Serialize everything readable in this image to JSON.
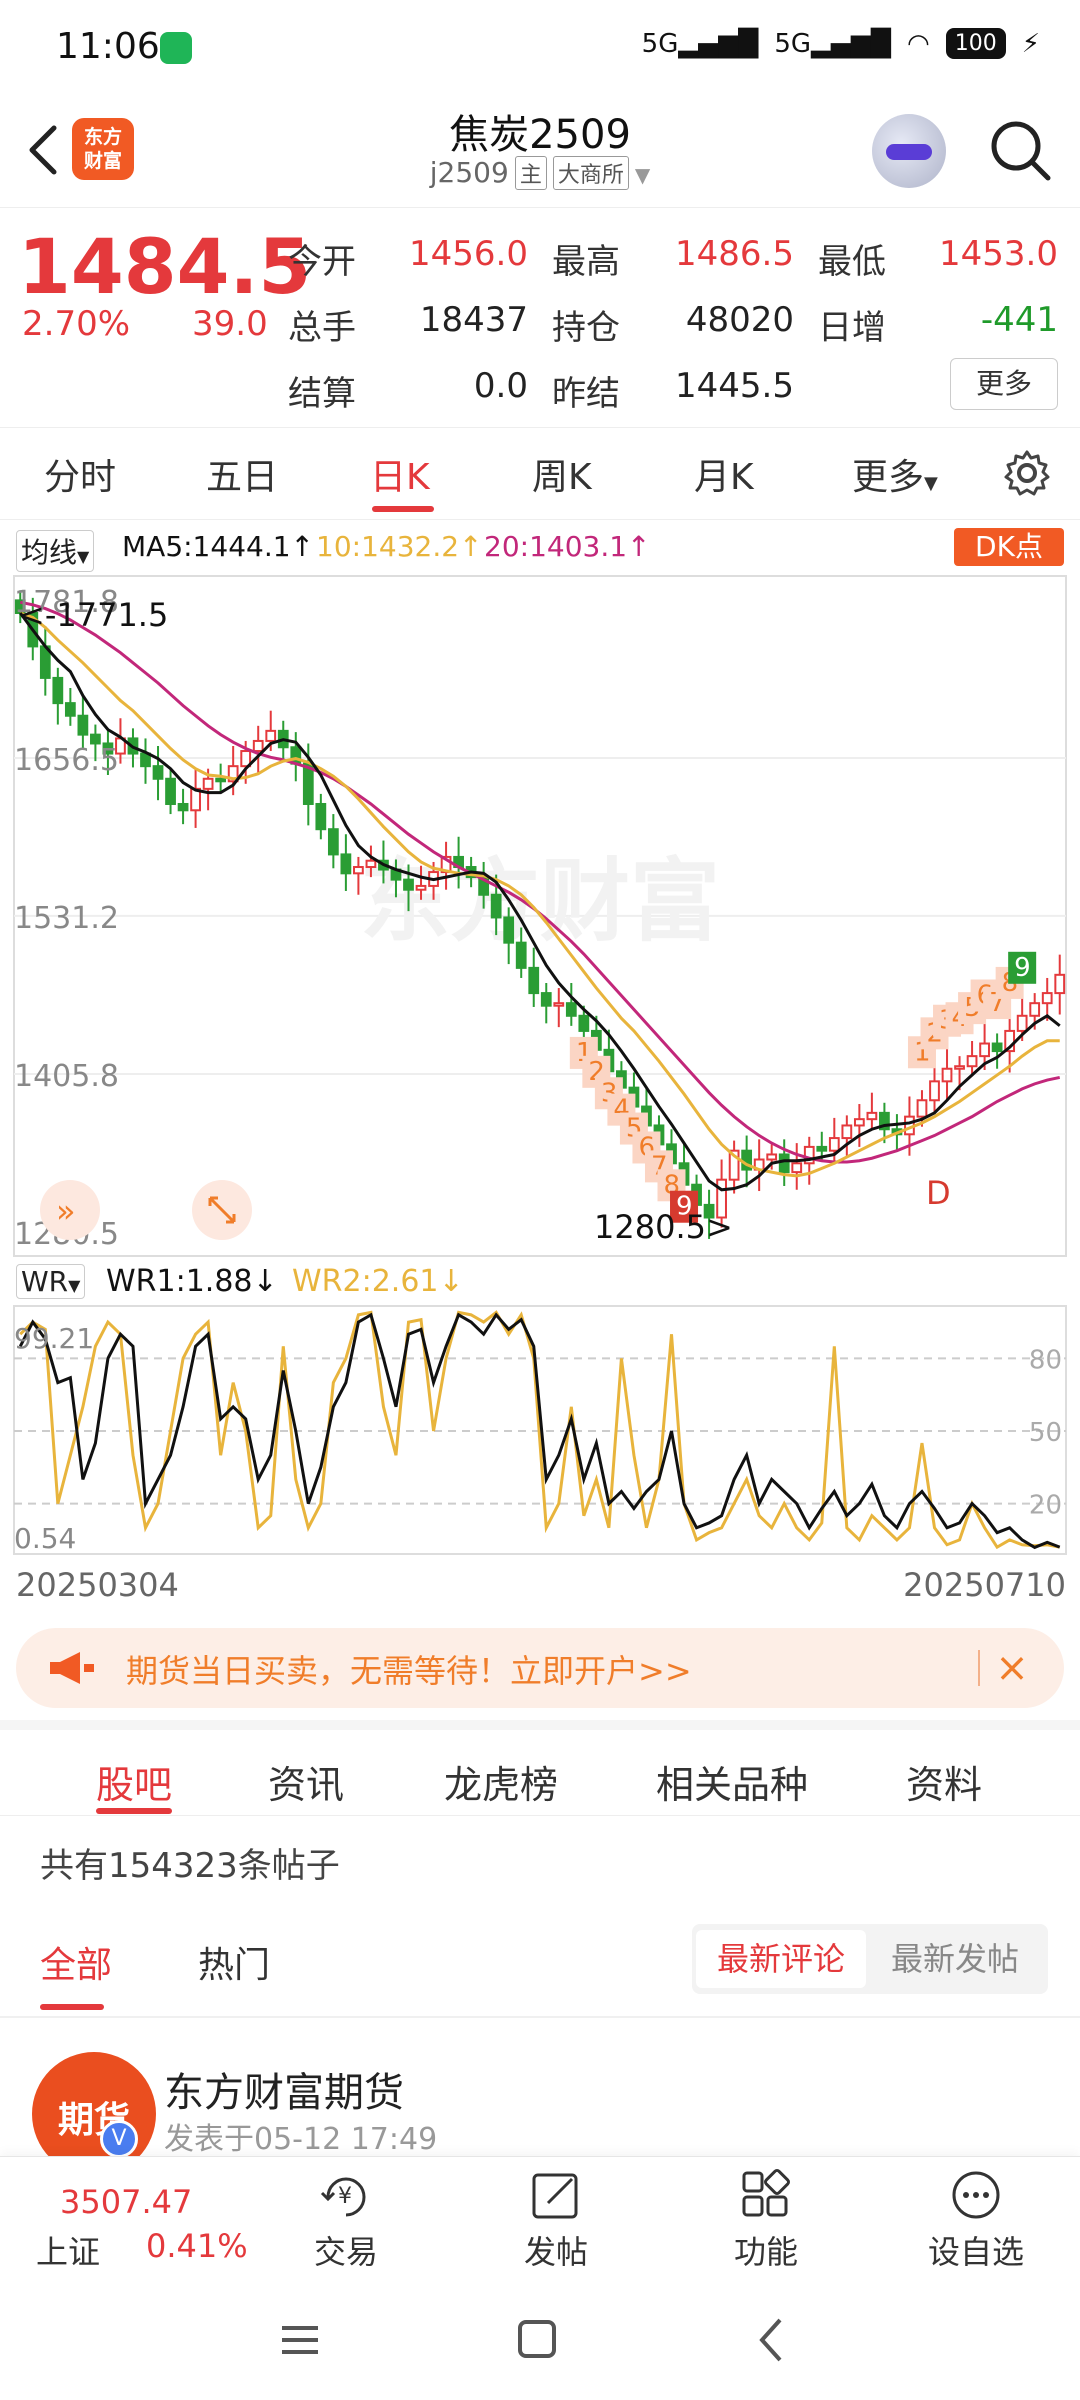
{
  "status_bar": {
    "time": "11:06",
    "network1": "5G",
    "network2": "5G",
    "battery": "100"
  },
  "header": {
    "logo_line1": "东方",
    "logo_line2": "财富",
    "title": "焦炭2509",
    "code": "j2509",
    "tag_main": "主",
    "tag_exchange": "大商所"
  },
  "quote": {
    "price": "1484.5",
    "change_pct": "2.70%",
    "change": "39.0",
    "fields": [
      {
        "label": "今开",
        "value": "1456.0",
        "color": "red"
      },
      {
        "label": "最高",
        "value": "1486.5",
        "color": "red"
      },
      {
        "label": "最低",
        "value": "1453.0",
        "color": "red"
      },
      {
        "label": "总手",
        "value": "18437",
        "color": "dark"
      },
      {
        "label": "持仓",
        "value": "48020",
        "color": "dark"
      },
      {
        "label": "日增",
        "value": "-441",
        "color": "green"
      },
      {
        "label": "结算",
        "value": "0.0",
        "color": "dark"
      },
      {
        "label": "昨结",
        "value": "1445.5",
        "color": "dark"
      }
    ],
    "more_button": "更多"
  },
  "period_tabs": [
    "分时",
    "五日",
    "日K",
    "周K",
    "月K",
    "更多"
  ],
  "period_active": "日K",
  "ma_legend": {
    "selector": "均线",
    "ma5": "MA5:1444.1",
    "ma10": "10:1432.2",
    "ma20": "20:1403.1",
    "dk_button": "DK点"
  },
  "colors": {
    "up": "#e4393c",
    "down": "#2a9d34",
    "ma5": "#111111",
    "ma10": "#e8b43c",
    "ma20": "#c2277a",
    "accent": "#f15a24"
  },
  "chart_data": [
    {
      "type": "candlestick",
      "title": "",
      "y_axis_labels": [
        "1781.8",
        "1656.5",
        "1531.2",
        "1405.8",
        "1280.5"
      ],
      "ylim": [
        1280.5,
        1781.8
      ],
      "max_marker": "1771.5",
      "min_marker": "1280.5",
      "signal_labels": [
        "D",
        "9",
        "9"
      ],
      "td_sequence_down": [
        "1",
        "2",
        "3",
        "4",
        "5",
        "6",
        "7",
        "8",
        "9"
      ],
      "td_sequence_up": [
        "1",
        "2",
        "3",
        "4",
        "5",
        "6",
        "7",
        "8",
        "9"
      ],
      "x_start": "20250304",
      "x_end": "20250710",
      "close": [
        1771.5,
        1745,
        1720,
        1700,
        1690,
        1675,
        1668,
        1660,
        1672,
        1660,
        1650,
        1640,
        1620,
        1615,
        1632,
        1640,
        1638,
        1650,
        1662,
        1670,
        1678,
        1665,
        1652,
        1620,
        1600,
        1580,
        1565,
        1570,
        1575,
        1568,
        1560,
        1552,
        1555,
        1566,
        1578,
        1570,
        1562,
        1548,
        1530,
        1510,
        1490,
        1470,
        1460,
        1462,
        1452,
        1440,
        1425,
        1408,
        1395,
        1380,
        1365,
        1350,
        1335,
        1318,
        1302,
        1292,
        1322,
        1345,
        1330,
        1338,
        1342,
        1328,
        1335,
        1348,
        1345,
        1355,
        1365,
        1370,
        1375,
        1362,
        1358,
        1372,
        1385,
        1400,
        1410,
        1412,
        1420,
        1430,
        1424,
        1440,
        1452,
        1462,
        1470,
        1484.5
      ],
      "ma5": [
        1771.5,
        1758,
        1745,
        1734,
        1725,
        1706,
        1691,
        1679,
        1673,
        1665,
        1661,
        1656,
        1648,
        1637,
        1631,
        1629,
        1629,
        1635,
        1648,
        1658,
        1668,
        1671,
        1669,
        1657,
        1643,
        1623,
        1603,
        1587,
        1578,
        1572,
        1568,
        1565,
        1562,
        1560,
        1562,
        1564,
        1566,
        1565,
        1558,
        1544,
        1528,
        1510,
        1492,
        1478,
        1467,
        1457,
        1448,
        1437,
        1424,
        1410,
        1395,
        1380,
        1366,
        1351,
        1336,
        1321,
        1314,
        1315,
        1318,
        1325,
        1335,
        1337,
        1337,
        1338,
        1340,
        1342,
        1350,
        1357,
        1362,
        1365,
        1366,
        1367,
        1370,
        1375,
        1385,
        1396,
        1405,
        1414,
        1419,
        1427,
        1437,
        1446,
        1452,
        1444.1
      ],
      "ma10": [
        1771.5,
        1768,
        1760,
        1750,
        1741,
        1732,
        1722,
        1712,
        1702,
        1694,
        1684,
        1674,
        1664,
        1655,
        1648,
        1643,
        1642,
        1640,
        1641,
        1644,
        1650,
        1654,
        1656,
        1653,
        1648,
        1642,
        1634,
        1624,
        1613,
        1602,
        1592,
        1582,
        1574,
        1569,
        1567,
        1565,
        1564,
        1563,
        1560,
        1555,
        1548,
        1538,
        1526,
        1513,
        1500,
        1487,
        1474,
        1462,
        1450,
        1440,
        1428,
        1416,
        1403,
        1390,
        1376,
        1362,
        1350,
        1341,
        1334,
        1330,
        1328,
        1326,
        1325,
        1327,
        1331,
        1335,
        1340,
        1345,
        1350,
        1355,
        1359,
        1363,
        1367,
        1372,
        1378,
        1384,
        1391,
        1398,
        1405,
        1412,
        1420,
        1427,
        1432.2,
        1432.2
      ],
      "ma20": [
        1780,
        1778,
        1775,
        1771,
        1766,
        1760,
        1754,
        1747,
        1740,
        1732,
        1724,
        1716,
        1707,
        1698,
        1690,
        1682,
        1675,
        1669,
        1664,
        1660,
        1657,
        1655,
        1652,
        1649,
        1645,
        1640,
        1634,
        1627,
        1620,
        1612,
        1604,
        1596,
        1589,
        1582,
        1576,
        1570,
        1565,
        1560,
        1555,
        1550,
        1544,
        1537,
        1529,
        1520,
        1511,
        1501,
        1490,
        1479,
        1468,
        1457,
        1446,
        1435,
        1424,
        1413,
        1402,
        1391,
        1381,
        1372,
        1364,
        1357,
        1351,
        1346,
        1342,
        1339,
        1337,
        1336,
        1336,
        1337,
        1339,
        1342,
        1345,
        1349,
        1353,
        1357,
        1362,
        1367,
        1372,
        1378,
        1384,
        1389,
        1394,
        1398,
        1401,
        1403.1
      ]
    },
    {
      "type": "line",
      "title": "",
      "indicator": "WR",
      "y_axis_labels": [
        "99.21",
        "0.54"
      ],
      "grid_labels": [
        "80",
        "50",
        "20"
      ],
      "ylim": [
        0,
        100
      ],
      "series": [
        {
          "name": "WR1:1.88",
          "values": [
            85,
            95,
            88,
            70,
            72,
            30,
            45,
            80,
            90,
            85,
            20,
            30,
            40,
            60,
            85,
            90,
            55,
            60,
            55,
            30,
            40,
            75,
            50,
            20,
            35,
            60,
            70,
            95,
            98,
            80,
            60,
            90,
            92,
            70,
            85,
            98,
            95,
            90,
            98,
            92,
            96,
            85,
            30,
            40,
            55,
            30,
            45,
            20,
            25,
            18,
            25,
            30,
            50,
            20,
            10,
            12,
            15,
            30,
            40,
            20,
            30,
            25,
            20,
            10,
            18,
            25,
            15,
            20,
            28,
            15,
            10,
            20,
            25,
            18,
            10,
            12,
            20,
            15,
            8,
            10,
            5,
            1.88,
            4,
            2
          ]
        },
        {
          "name": "WR2:2.61",
          "values": [
            90,
            95,
            92,
            20,
            40,
            60,
            85,
            95,
            90,
            40,
            10,
            20,
            50,
            80,
            90,
            95,
            40,
            70,
            50,
            10,
            15,
            85,
            30,
            10,
            20,
            70,
            80,
            98,
            99,
            60,
            40,
            95,
            96,
            50,
            80,
            99,
            98,
            95,
            99,
            90,
            98,
            80,
            10,
            20,
            60,
            15,
            30,
            10,
            80,
            40,
            10,
            30,
            90,
            20,
            5,
            8,
            10,
            20,
            30,
            15,
            10,
            20,
            10,
            5,
            12,
            85,
            10,
            5,
            15,
            10,
            5,
            10,
            45,
            10,
            3,
            5,
            20,
            10,
            2,
            5,
            3,
            2.61,
            3,
            2
          ]
        }
      ]
    }
  ],
  "wr_legend": {
    "selector": "WR",
    "wr1": "WR1:1.88",
    "wr2": "WR2:2.61"
  },
  "watermark": "东方财富",
  "ad": {
    "text": "期货当日买卖，无需等待！立即开户>>"
  },
  "section_tabs": [
    "股吧",
    "资讯",
    "龙虎榜",
    "相关品种",
    "资料"
  ],
  "post_count": "共有154323条帖子",
  "filter_tabs": [
    "全部",
    "热门"
  ],
  "sort_buttons": [
    "最新评论",
    "最新发帖"
  ],
  "post": {
    "avatar_text": "期货",
    "author": "东方财富期货",
    "time": "发表于05-12 17:49"
  },
  "bottom_nav": {
    "index_value": "3507.47",
    "index_name": "上证",
    "index_pct": "0.41%",
    "items": [
      "交易",
      "发帖",
      "功能",
      "设自选"
    ]
  }
}
